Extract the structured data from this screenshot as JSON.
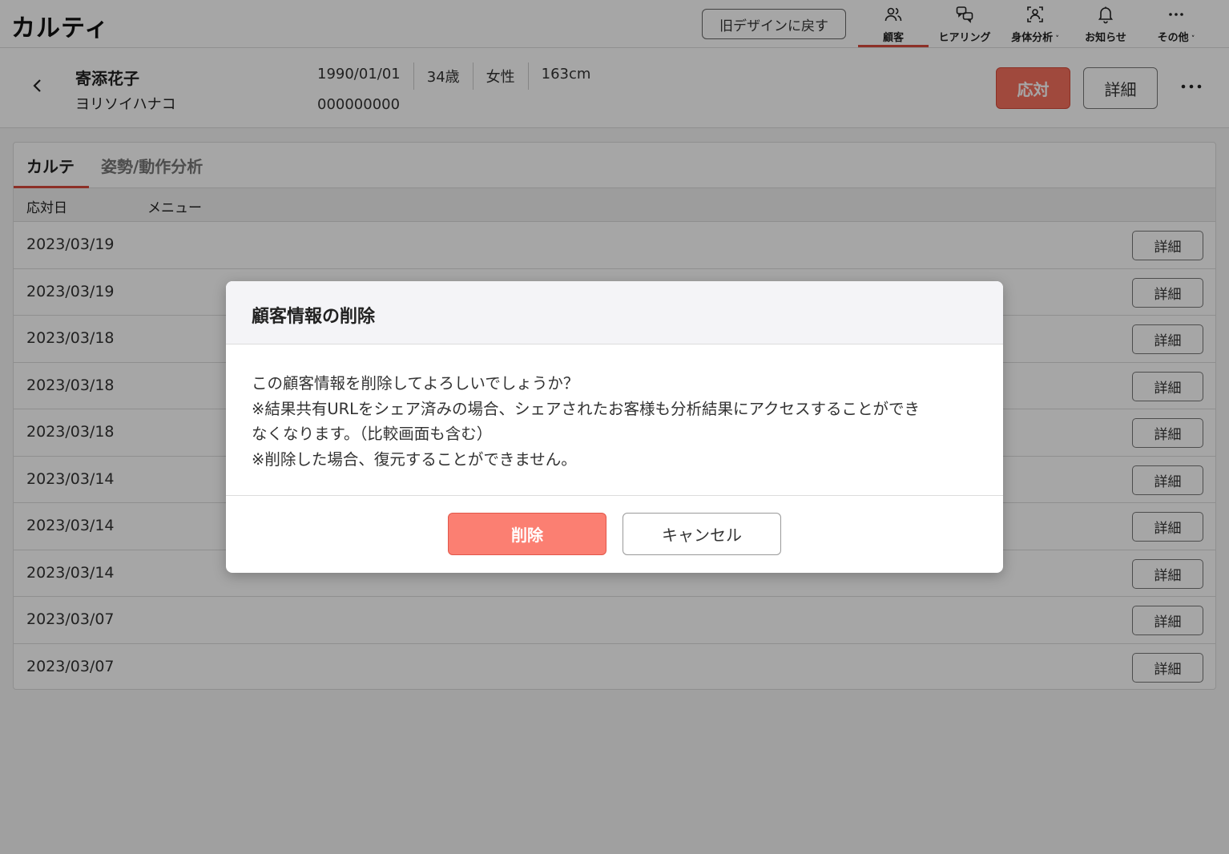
{
  "app": {
    "title": "カルティ"
  },
  "header": {
    "old_design_label": "旧デザインに戻す",
    "nav": [
      {
        "label": "顧客",
        "icon": "users-icon",
        "active": true
      },
      {
        "label": "ヒアリング",
        "icon": "chat-icon",
        "active": false
      },
      {
        "label": "身体分析",
        "icon": "body-scan-icon",
        "dropdown": true
      },
      {
        "label": "お知らせ",
        "icon": "bell-icon",
        "active": false
      },
      {
        "label": "その他",
        "icon": "more-icon",
        "dropdown": true
      }
    ],
    "accent": "#d94a3c"
  },
  "customer": {
    "name": "寄添花子",
    "kana": "ヨリソイハナコ",
    "birthdate": "1990/01/01",
    "age": "34歳",
    "gender": "女性",
    "height": "163cm",
    "id": "000000000",
    "respond_label": "応対",
    "detail_label": "詳細"
  },
  "tabs": [
    {
      "label": "カルテ",
      "active": true
    },
    {
      "label": "姿勢/動作分析",
      "active": false
    }
  ],
  "table": {
    "headers": [
      "応対日",
      "メニュー"
    ],
    "rows": [
      {
        "date": "2023/03/19",
        "menu": "",
        "button": "詳細"
      },
      {
        "date": "2023/03/19",
        "menu": "",
        "button": "詳細"
      },
      {
        "date": "2023/03/18",
        "menu": "",
        "button": "詳細"
      },
      {
        "date": "2023/03/18",
        "menu": "",
        "button": "詳細"
      },
      {
        "date": "2023/03/18",
        "menu": "",
        "button": "詳細"
      },
      {
        "date": "2023/03/14",
        "menu": "",
        "button": "詳細"
      },
      {
        "date": "2023/03/14",
        "menu": "",
        "button": "詳細"
      },
      {
        "date": "2023/03/14",
        "menu": "",
        "button": "詳細"
      },
      {
        "date": "2023/03/07",
        "menu": "",
        "button": "詳細"
      },
      {
        "date": "2023/03/07",
        "menu": "",
        "button": "詳細"
      }
    ]
  },
  "modal": {
    "title": "顧客情報の削除",
    "lines": [
      "この顧客情報を削除してよろしいでしょうか？",
      "※結果共有URLをシェア済みの場合、シェアされたお客様も分析結果にアクセスすることができ",
      "なくなります。（比較画面も含む）",
      "※削除した場合、復元することができません。"
    ],
    "delete_label": "削除",
    "cancel_label": "キャンセル",
    "delete_color": "#fb7f72"
  }
}
